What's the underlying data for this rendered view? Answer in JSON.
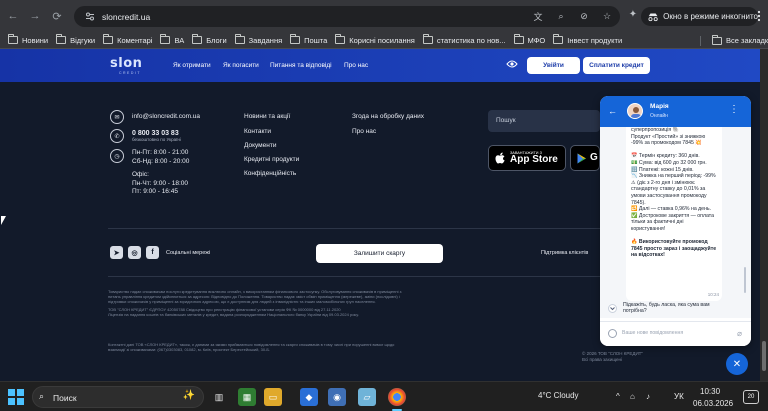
{
  "browser": {
    "url": "sloncredit.ua",
    "incognito_label": "Окно в режиме инкогнито",
    "bookmarks": [
      "Новини",
      "Відгуки",
      "Коментарі",
      "ВА",
      "Блоги",
      "Завдання",
      "Пошта",
      "Корисні посилання",
      "статистика по нов...",
      "МФО",
      "Інвест продукти"
    ],
    "all_bookmarks": "Все закладки"
  },
  "header": {
    "logo": "slon",
    "logo_sub": "CREDIT",
    "nav": [
      "Як отримати",
      "Як погасити",
      "Питання та відповіді",
      "Про нас"
    ],
    "login": "Увійти",
    "pay": "Сплатити кредит"
  },
  "contacts": {
    "email": "info@sloncredit.com.ua",
    "phone": "0 800 33 03 83",
    "phone_note": "безкоштовно по Україні",
    "hours_1": "Пн-Пт: 8:00 - 21:00",
    "hours_2": "Сб-Нд: 8:00 - 20:00",
    "office_label": "Офіс:",
    "office_1": "Пн-Чт: 9:00 - 18:00",
    "office_2": "Пт: 9:00 - 16:45"
  },
  "links_col1": [
    "Новини та акції",
    "Контакти",
    "Документи",
    "Кредитні продукти",
    "Конфіденційність"
  ],
  "links_col2": [
    "Згода на обробку даних",
    "Про нас"
  ],
  "search": {
    "placeholder": "Пошук"
  },
  "stores": {
    "apple_top": "ЗАВАНТАЖИТИ З",
    "apple_name": "App Store",
    "google_name": "G"
  },
  "social": {
    "label": "Соціальні мережі",
    "complaint": "Залишити скаргу",
    "support": "Підтримка клієнтів"
  },
  "legal": {
    "p1": "Товариство надає споживачам послуги кредитування виключно онлайн, з використанням фінансового застосунку. Обслуговування споживачів в приміщенні з питань управління кредитом здійснюється за адресою: Відповідно до Положення. Товариство надає зміст обмін приміщення (мережеве), зміни (послідовні) і підтримки спожичачів у приміщенні за юридичною адресою, що є доступним для людей з інвалідністю та інших маломобільних груп населення.",
    "p2": "ТОВ \"СЛОН КРЕДИТ\" ЄДРПОУ 42050788 Свідоцтво про реєстрацію фінансової установи серія ФК № 0000000 від 27.11.2020",
    "p3": "Ліцензія на надання коштів та банківських металів у кредит, видана розпорядженням Національного банку України від 09.03.2024 року.",
    "p4": "Контактні дані ТОВ «СЛОН КРЕДИТ», також, є даними за якими приймаються повідомлення та скарги споживачів в тому числі при порушенні вимог щодо взаємодії зі споживачами: (067)0303083, 01082, м. Київ, проспект Берестейський, 30-Б."
  },
  "copyright": {
    "line1": "© 2026 ТОВ \"СЛОН КРЕДИТ\"",
    "line2": "Всі права захищені"
  },
  "chat": {
    "agent_name": "Марія",
    "agent_status": "Онлайн",
    "message_lines": [
      "суперпропозиція 🐘",
      "Продукт «Простий» зі знижкою -99% за промокодом 7845 💥",
      "",
      "📅 Термін кредиту: 360 днів.",
      "💵 Сума: від 600 до 32 000 грн.",
      "🔢 Платежі: кожні 15 днів.",
      "📉 Знижка на перший період: -99% ⚠ (діє з 2-го дня і змінюює стандартну ставку до 0,01% за умови застосування промокоду 7845).",
      "🔁 Далі — ставка 0,96% на день.",
      "✅ Дострокове закриття — оплата тільки за фактичні дні користування!",
      "",
      "🔥 Використовуйте промокод 7845 просто зараз і заощаджуйте на відсотках!"
    ],
    "message_time": "10:24",
    "reply": "Підкажіть, будь ласка, яка сума вам потрібна?",
    "input_placeholder": "Ваше нове повідомлення"
  },
  "taskbar": {
    "search_label": "Поиск",
    "weather": "4°C  Cloudy",
    "lang": "УК",
    "time": "10:30",
    "date": "06.03.2026",
    "notifications": "20"
  },
  "colors": {
    "brand_blue": "#1a3aa8",
    "chat_blue": "#1565d8",
    "footer_bg": "#121a2a"
  }
}
